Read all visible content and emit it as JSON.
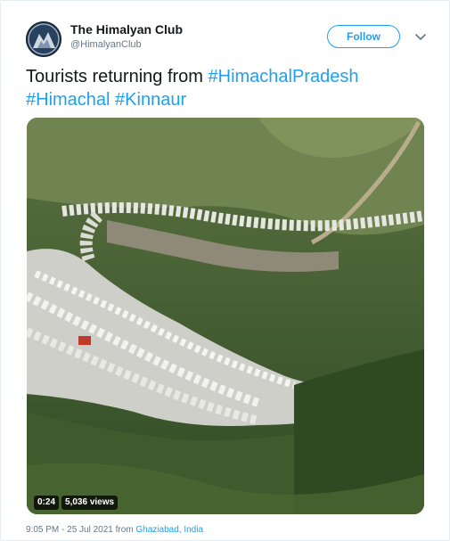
{
  "account": {
    "name": "The Himalyan Club",
    "handle": "@HimalyanClub",
    "avatar": "club-avatar-icon"
  },
  "actions": {
    "follow_label": "Follow",
    "more_icon": "chevron-down-icon"
  },
  "tweet": {
    "text_prefix": "Tourists returning from ",
    "hashtags": [
      "#HimachalPradesh",
      "#Himachal",
      "#Kinnaur"
    ]
  },
  "media": {
    "duration": "0:24",
    "views": "5,036 views"
  },
  "footer": {
    "timestamp": "9:05 PM - 25 Jul 2021",
    "from_label": "from",
    "location": "Ghaziabad, India"
  },
  "colors": {
    "accent": "#1da1f2",
    "text": "#14171a",
    "muted": "#657786"
  }
}
